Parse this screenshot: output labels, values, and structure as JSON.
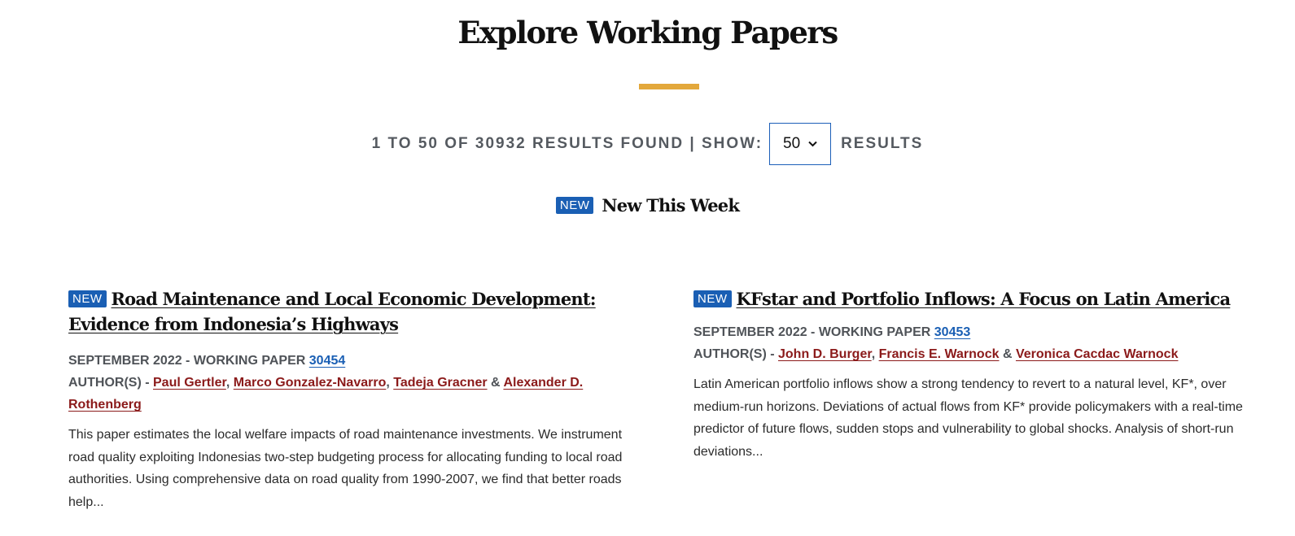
{
  "page": {
    "title": "Explore Working Papers"
  },
  "results": {
    "count_text": "1 TO 50 OF 30932 RESULTS FOUND | SHOW:",
    "per_page_value": "50",
    "suffix": "RESULTS"
  },
  "new_this_week": {
    "badge": "NEW",
    "label": "New This Week"
  },
  "papers": [
    {
      "badge": "NEW",
      "title": "Road Maintenance and Local Economic Development: Evidence from Indonesia’s Highways",
      "date_type": "SEPTEMBER 2022 - WORKING PAPER",
      "paper_number": "30454",
      "authors_prefix": "AUTHOR(S) -",
      "authors": [
        "Paul Gertler",
        "Marco Gonzalez-Navarro",
        "Tadeja Gracner",
        "Alexander D. Rothenberg"
      ],
      "abstract": "This paper estimates the local welfare impacts of road maintenance investments. We instrument road quality exploiting Indonesias two-step budgeting process for allocating funding to local road authorities. Using comprehensive data on road quality from 1990-2007, we find that better roads help..."
    },
    {
      "badge": "NEW",
      "title": "KFstar and Portfolio Inflows: A Focus on Latin America",
      "date_type": "SEPTEMBER 2022 - WORKING PAPER",
      "paper_number": "30453",
      "authors_prefix": "AUTHOR(S) -",
      "authors": [
        "John D. Burger",
        "Francis E. Warnock",
        "Veronica Cacdac Warnock"
      ],
      "abstract": "Latin American portfolio inflows show a strong tendency to revert to a natural level, KF*, over medium-run horizons. Deviations of actual flows from KF* provide policymakers with a real-time predictor of future flows, sudden stops and vulnerability to global shocks. Analysis of short-run deviations..."
    }
  ],
  "separators": {
    "comma": ",",
    "and": "&"
  },
  "icons": {
    "select_chevron": "chevron-down-icon"
  },
  "colors": {
    "accent_gold": "#e3a83b",
    "badge_blue": "#1a5fb4",
    "author_red": "#8b1a1a"
  }
}
